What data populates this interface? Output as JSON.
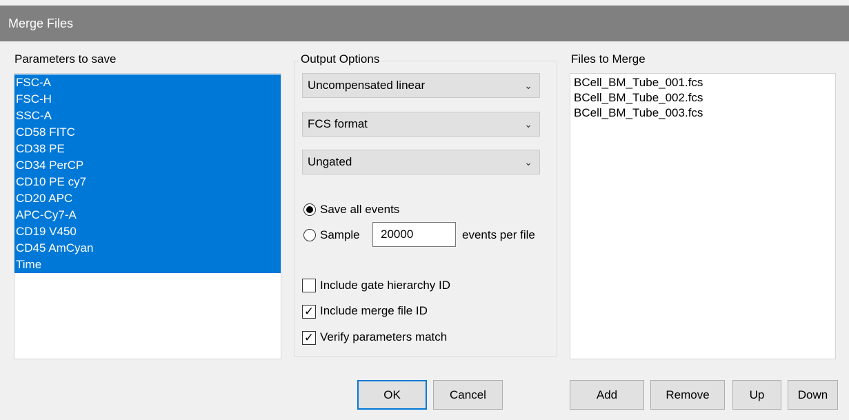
{
  "window": {
    "title": "Merge Files"
  },
  "parameters": {
    "label": "Parameters to save",
    "items": [
      "FSC-A",
      "FSC-H",
      "SSC-A",
      "CD58 FITC",
      "CD38 PE",
      "CD34 PerCP",
      "CD10 PE cy7",
      "CD20 APC",
      "APC-Cy7-A",
      "CD19 V450",
      "CD45 AmCyan",
      "Time"
    ]
  },
  "output_options": {
    "label": "Output Options",
    "compensation": "Uncompensated linear",
    "format": "FCS format",
    "gating": "Ungated",
    "save_all_label": "Save all events",
    "save_all_selected": true,
    "sample_label": "Sample",
    "sample_value": "20000",
    "events_per_file_label": "events per file",
    "include_gate_hierarchy_label": "Include gate hierarchy ID",
    "include_gate_hierarchy_checked": false,
    "include_merge_file_label": "Include merge file ID",
    "include_merge_file_checked": true,
    "verify_params_label": "Verify parameters match",
    "verify_params_checked": true
  },
  "files": {
    "label": "Files to Merge",
    "items": [
      "BCell_BM_Tube_001.fcs",
      "BCell_BM_Tube_002.fcs",
      "BCell_BM_Tube_003.fcs"
    ]
  },
  "buttons": {
    "ok": "OK",
    "cancel": "Cancel",
    "add": "Add",
    "remove": "Remove",
    "up": "Up",
    "down": "Down"
  },
  "colors": {
    "selection": "#0078d7",
    "titlebar": "#808080"
  }
}
